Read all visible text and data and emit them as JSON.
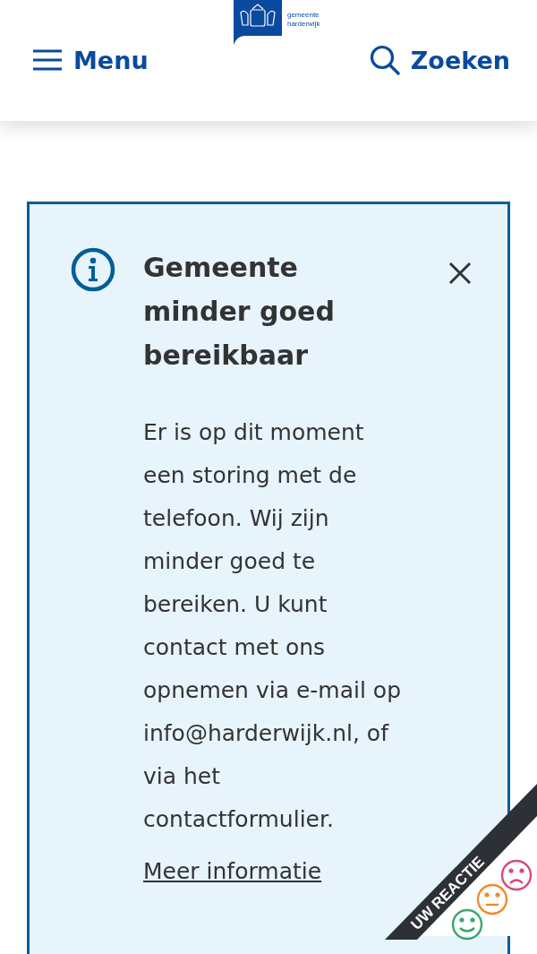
{
  "header": {
    "menu_label": "Menu",
    "logo_text": [
      "gemeente",
      "harderwijk"
    ],
    "search_label": "Zoeken"
  },
  "alert": {
    "title": "Gemeente minder goed bereikbaar",
    "body": "Er is op dit moment een storing met de telefoon. Wij zijn minder goed te bereiken. U kunt contact met ons opnemen via e-mail op info@harderwijk.nl, of via het contactformulier.",
    "link": "Meer informatie"
  },
  "feedback_tab": {
    "label": "UW REACTIE"
  }
}
